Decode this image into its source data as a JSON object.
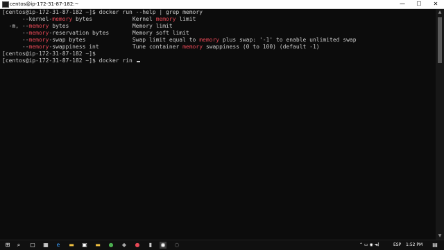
{
  "window": {
    "title": "centos@ip-172-31-87-182:~",
    "minimize": "—",
    "maximize": "☐",
    "close": "✕"
  },
  "terminal": {
    "prompt1": "[centos@ip-172-31-87-182 ~]$ docker run --help | grep memory",
    "opts": [
      {
        "pre": "      --kernel-",
        "hl": "memory",
        "post": " bytes            ",
        "desc_pre": "Kernel ",
        "desc_hl": "memory",
        "desc_post": " limit"
      },
      {
        "pre": "  -m, --",
        "hl": "memory",
        "post": " bytes                   ",
        "desc_pre": "Memory limit",
        "desc_hl": "",
        "desc_post": ""
      },
      {
        "pre": "      --",
        "hl": "memory",
        "post": "-reservation bytes       ",
        "desc_pre": "Memory soft limit",
        "desc_hl": "",
        "desc_post": ""
      },
      {
        "pre": "      --",
        "hl": "memory",
        "post": "-swap bytes              ",
        "desc_pre": "Swap limit equal to ",
        "desc_hl": "memory",
        "desc_post": " plus swap: '-1' to enable unlimited swap"
      },
      {
        "pre": "      --",
        "hl": "memory",
        "post": "-swappiness int          ",
        "desc_pre": "Tune container ",
        "desc_hl": "memory",
        "desc_post": " swappiness (0 to 100) (default -1)"
      }
    ],
    "prompt2": "[centos@ip-172-31-87-182 ~]$",
    "prompt3": "[centos@ip-172-31-87-182 ~]$ docker rin "
  },
  "taskbar": {
    "icons": [
      "windows-start-icon",
      "search-icon",
      "task-view-icon",
      "edge-icon",
      "file-explorer-icon",
      "store-icon",
      "chrome-icon",
      "media-icon",
      "terminal-icon",
      "vm-icon",
      "app-icon"
    ],
    "tray_icons": "⌃ ▭ ◉ ◄)",
    "language": "ESP",
    "time": "1:52 PM"
  }
}
